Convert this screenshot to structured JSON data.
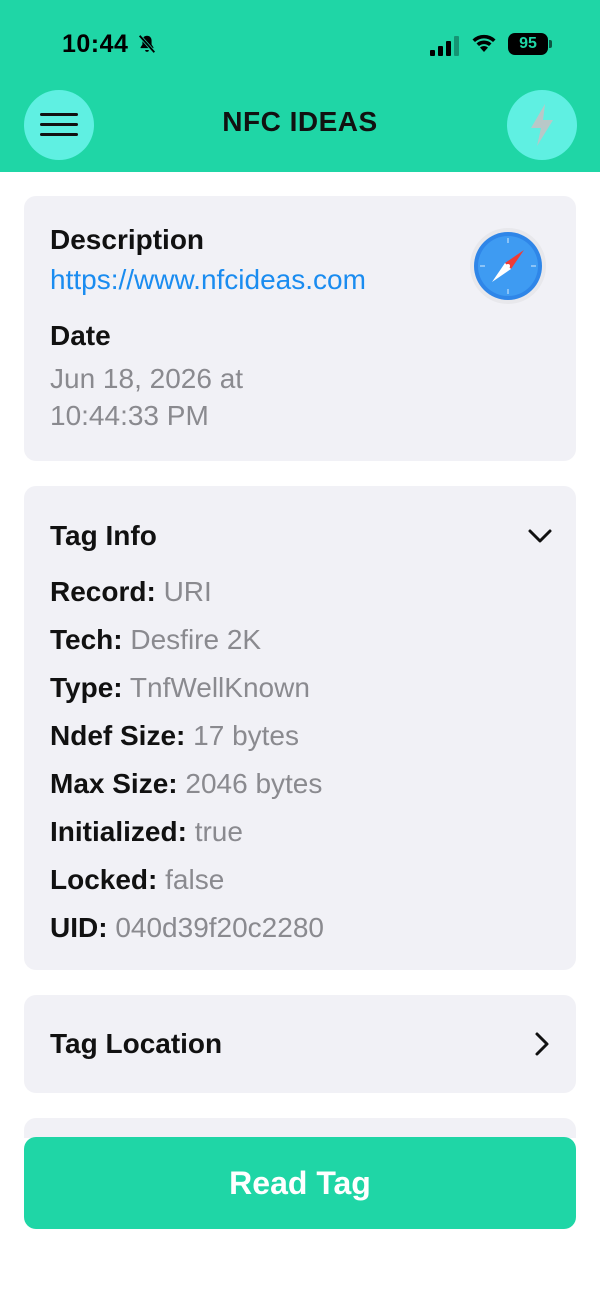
{
  "status_bar": {
    "time": "10:44",
    "battery": "95",
    "icons": [
      "bell-slash-icon",
      "signal-icon",
      "wifi-icon",
      "battery-icon"
    ]
  },
  "header": {
    "title": "NFC IDEAS",
    "menu_icon": "hamburger-menu-icon",
    "action_icon": "lightning-bolt-icon",
    "background_color": "#1fd6a6",
    "button_color": "#5ff0e2"
  },
  "record_card": {
    "description_label": "Description",
    "description_value": "https://www.nfcideas.com",
    "date_label": "Date",
    "date_value": "Jun 18, 2026 at 10:44:33 PM",
    "app_icon": "safari-icon"
  },
  "tag_info": {
    "title": "Tag Info",
    "toggle_icon": "chevron-down-icon",
    "rows": [
      {
        "key": "Record:",
        "value": "URI"
      },
      {
        "key": "Tech:",
        "value": "Desfire 2K"
      },
      {
        "key": "Type:",
        "value": "TnfWellKnown"
      },
      {
        "key": "Ndef Size:",
        "value": "17 bytes"
      },
      {
        "key": "Max Size:",
        "value": "2046 bytes"
      },
      {
        "key": "Initialized:",
        "value": "true"
      },
      {
        "key": "Locked:",
        "value": "false"
      },
      {
        "key": "UID:",
        "value": "040d39f20c2280"
      }
    ]
  },
  "tag_location": {
    "title": "Tag Location",
    "icon": "chevron-right-icon"
  },
  "read_button": {
    "label": "Read Tag",
    "color": "#1fd6a6"
  },
  "colors": {
    "link": "#1a8cf0",
    "card": "#f1f1f6",
    "muted_text": "#8a8a8f"
  }
}
